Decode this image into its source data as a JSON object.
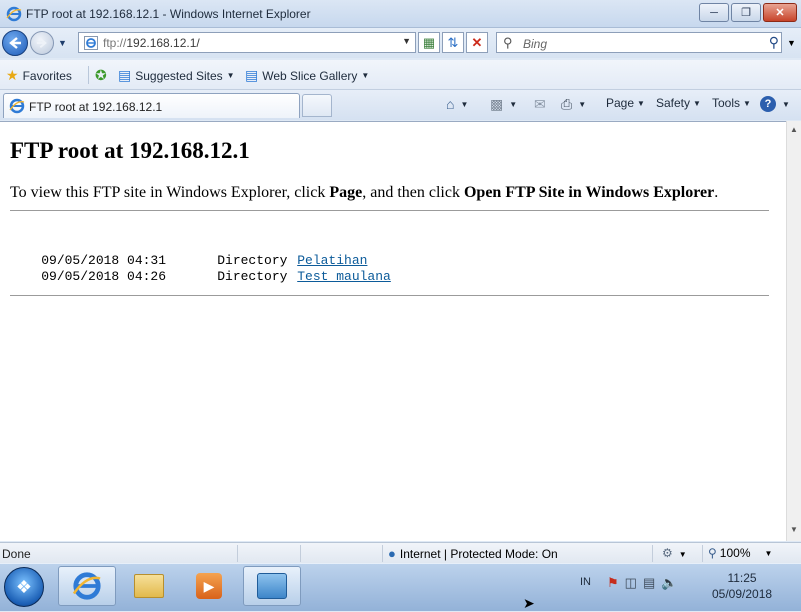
{
  "window": {
    "title": "FTP root at 192.168.12.1 - Windows Internet Explorer",
    "minimize_icon": "minimize-icon",
    "maximize_icon": "restore-icon",
    "close_icon": "close-icon"
  },
  "address_bar": {
    "url_prefix": "ftp://",
    "url_host": "192.168.12.1/",
    "search_placeholder": "Bing"
  },
  "favorites_bar": {
    "favorites_label": "Favorites",
    "suggested_sites_label": "Suggested Sites",
    "web_slice_label": "Web Slice Gallery"
  },
  "tab": {
    "label": "FTP root at 192.168.12.1"
  },
  "command_bar": {
    "page_label": "Page",
    "safety_label": "Safety",
    "tools_label": "Tools"
  },
  "page": {
    "heading": "FTP root at 192.168.12.1",
    "intro_prefix": "To view this FTP site in Windows Explorer, click ",
    "intro_page": "Page",
    "intro_middle": ", and then click ",
    "intro_action": "Open FTP Site in Windows Explorer",
    "intro_suffix": ".",
    "entries": [
      {
        "date": "09/05/2018 04:31",
        "type": "Directory",
        "name": "Pelatihan"
      },
      {
        "date": "09/05/2018 04:26",
        "type": "Directory",
        "name": "Test maulana"
      }
    ]
  },
  "status_bar": {
    "status": "Done",
    "zone": "Internet | Protected Mode: On",
    "zoom": "100%"
  },
  "taskbar": {
    "language": "IN",
    "time": "11:25",
    "date": "05/09/2018"
  }
}
